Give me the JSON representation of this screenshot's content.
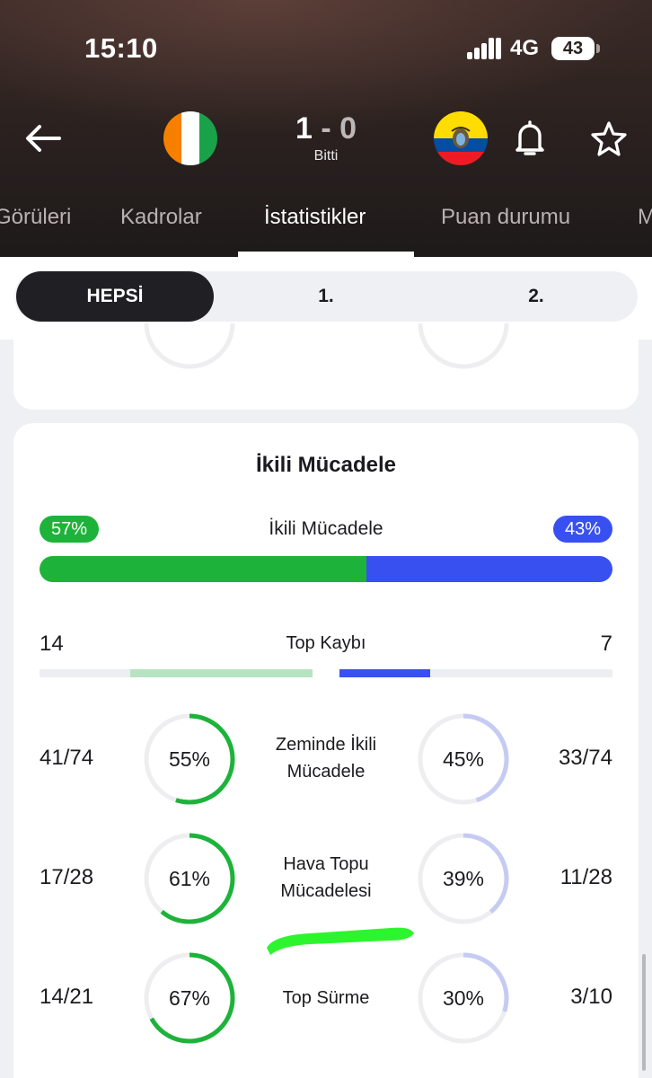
{
  "status_bar": {
    "time": "15:10",
    "network": "4G",
    "battery": "43"
  },
  "match": {
    "home_score": "1",
    "separator": "-",
    "away_score": "0",
    "status": "Bitti",
    "home_flag": "cote-divoire-flag",
    "away_flag": "ecuador-flag"
  },
  "tabs": [
    {
      "label": "Görüleri"
    },
    {
      "label": "Kadrolar"
    },
    {
      "label": "İstatistikler"
    },
    {
      "label": "Puan durumu"
    },
    {
      "label": "M"
    }
  ],
  "period_segment": {
    "options": [
      "HEPSİ",
      "1.",
      "2."
    ],
    "selected": "HEPSİ"
  },
  "section": {
    "title": "İkili Mücadele",
    "duels": {
      "label": "İkili Mücadele",
      "home_pct": "57%",
      "away_pct": "43%",
      "home_fraction": 0.57
    },
    "turnovers": {
      "label": "Top Kaybı",
      "home": "14",
      "away": "7",
      "home_fraction": 0.667,
      "away_fraction": 0.333
    },
    "stats": [
      {
        "label": "Zeminde İkili Mücadele",
        "home_value": "41/74",
        "home_pct": "55%",
        "home_fraction": 0.55,
        "away_value": "33/74",
        "away_pct": "45%",
        "away_fraction": 0.45
      },
      {
        "label": "Hava Topu Mücadelesi",
        "home_value": "17/28",
        "home_pct": "61%",
        "home_fraction": 0.61,
        "away_value": "11/28",
        "away_pct": "39%",
        "away_fraction": 0.39
      },
      {
        "label": "Top Sürme",
        "home_value": "14/21",
        "home_pct": "67%",
        "home_fraction": 0.67,
        "away_value": "3/10",
        "away_pct": "30%",
        "away_fraction": 0.3
      }
    ]
  },
  "colors": {
    "home": "#1db33a",
    "away": "#3950f0",
    "away_light": "#c6cbf3",
    "home_light": "#b6e3c0",
    "track": "#eeeef1",
    "highlight": "#2df52d"
  },
  "icons": [
    "back-arrow-icon",
    "bell-icon",
    "star-icon",
    "signal-icon",
    "battery-icon"
  ]
}
